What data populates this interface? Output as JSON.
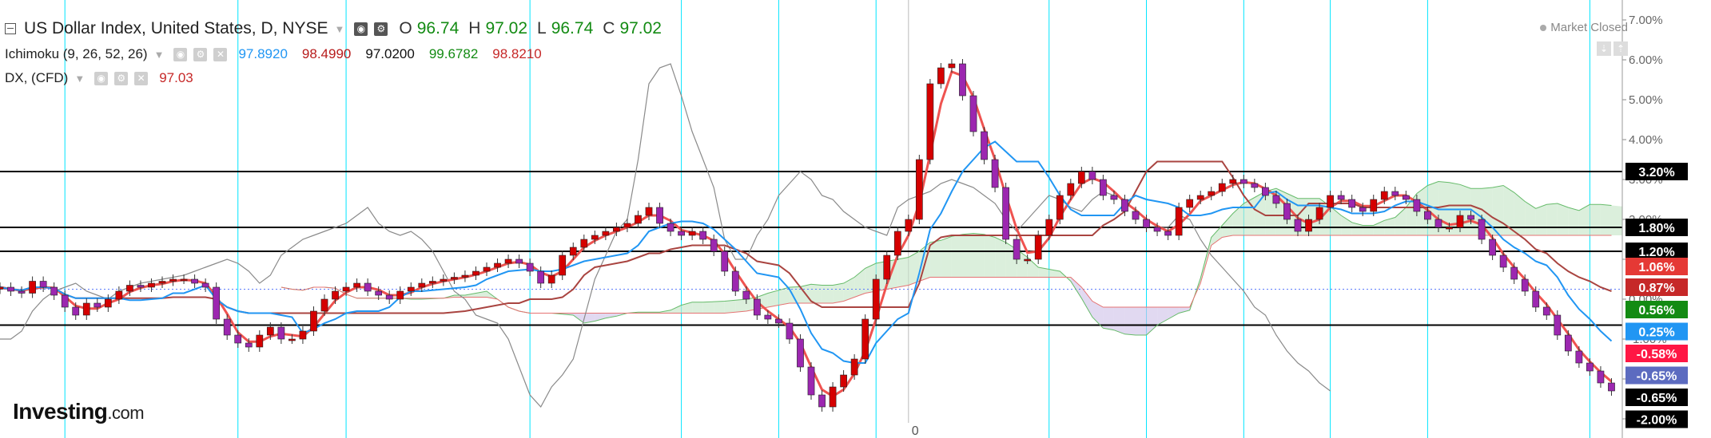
{
  "header": {
    "title": "US Dollar Index, United States, D, NYSE",
    "ohlc": [
      {
        "key": "O",
        "value": "96.74"
      },
      {
        "key": "H",
        "value": "97.02"
      },
      {
        "key": "L",
        "value": "96.74"
      },
      {
        "key": "C",
        "value": "97.02"
      }
    ]
  },
  "indicators": {
    "ichimoku": {
      "label": "Ichimoku (9, 26, 52, 26)",
      "values": [
        {
          "value": "97.8920",
          "color": "#2196f3"
        },
        {
          "value": "98.4990",
          "color": "#b71c1c"
        },
        {
          "value": "97.0200",
          "color": "#111111"
        },
        {
          "value": "99.6782",
          "color": "#138b13"
        },
        {
          "value": "98.8210",
          "color": "#c62828"
        }
      ]
    },
    "dx": {
      "label": "DX, (CFD)",
      "value": "97.03",
      "value_color": "#c62828"
    }
  },
  "status": {
    "market": "Market Closed"
  },
  "logo": {
    "brand": "Investing",
    "suffix": ".com"
  },
  "colors": {
    "up_candle": "#d50000",
    "down_candle": "#9c27b0",
    "tenkan": "#2196f3",
    "kijun": "#a94440",
    "chikou": "#8a8a8a",
    "dx_line": "#ef5350",
    "cloud_bull": "#c8e6c9",
    "cloud_bear": "#d1c4e9",
    "vertical_grid": "#00e5ff"
  },
  "chart_data": {
    "type": "candlestick",
    "y_axis": {
      "unit": "%",
      "range": [
        -3.4,
        7.3
      ],
      "ticks": [
        "7.00%",
        "6.00%",
        "5.00%",
        "4.00%",
        "3.00%",
        "2.00%",
        "1.00%",
        "0.00%",
        "-1.00%",
        "-2.00%",
        "-3.00%"
      ]
    },
    "x_axis_label": "0",
    "x_index_range": [
      0,
      150
    ],
    "baseline_index": 84,
    "baseline_value": 0.25,
    "horizontal_levels": [
      3.2,
      1.8,
      1.2,
      -0.65
    ],
    "price_labels": [
      {
        "text": "3.20%",
        "value": 3.2,
        "color": "#000000"
      },
      {
        "text": "1.80%",
        "value": 1.8,
        "color": "#000000"
      },
      {
        "text": "1.20%",
        "value": 1.2,
        "color": "#000000"
      },
      {
        "text": "1.06%",
        "value": 0.82,
        "color": "#e53935"
      },
      {
        "text": "0.87%",
        "value": 0.3,
        "color": "#c62828"
      },
      {
        "text": "0.56%",
        "value": -0.26,
        "color": "#138b13"
      },
      {
        "text": "0.25%",
        "value": -0.81,
        "color": "#2196f3"
      },
      {
        "text": "-0.58%",
        "value": -1.36,
        "color": "#ff1744"
      },
      {
        "text": "-0.65%",
        "value": -1.91,
        "color": "#5c6bc0"
      },
      {
        "text": "-0.65%",
        "value": -2.46,
        "color": "#000000"
      },
      {
        "text": "-2.00%",
        "value": -3.01,
        "color": "#000000"
      }
    ],
    "vertical_gridlines": [
      6,
      22,
      32,
      49,
      63,
      72,
      81,
      97,
      106,
      115,
      123,
      132,
      147
    ],
    "close": [
      0.3,
      0.2,
      0.15,
      0.45,
      0.3,
      0.1,
      -0.2,
      -0.4,
      -0.1,
      -0.2,
      0.0,
      0.2,
      0.35,
      0.3,
      0.4,
      0.45,
      0.5,
      0.5,
      0.4,
      0.3,
      -0.5,
      -0.9,
      -1.1,
      -1.2,
      -0.9,
      -0.7,
      -1.0,
      -1.0,
      -0.8,
      -0.3,
      0.0,
      0.2,
      0.3,
      0.4,
      0.2,
      0.1,
      0.0,
      0.2,
      0.3,
      0.4,
      0.45,
      0.5,
      0.55,
      0.6,
      0.7,
      0.8,
      0.9,
      1.0,
      0.9,
      0.7,
      0.4,
      0.6,
      1.1,
      1.3,
      1.5,
      1.6,
      1.7,
      1.8,
      1.9,
      2.1,
      2.3,
      1.9,
      1.7,
      1.6,
      1.7,
      1.5,
      1.2,
      0.7,
      0.2,
      0.0,
      -0.4,
      -0.5,
      -0.6,
      -1.0,
      -1.7,
      -2.4,
      -2.7,
      -2.2,
      -1.9,
      -1.5,
      -0.5,
      0.5,
      1.1,
      1.7,
      2.0,
      3.5,
      5.4,
      5.8,
      5.9,
      5.1,
      4.2,
      3.5,
      2.8,
      1.5,
      1.0,
      1.0,
      1.6,
      2.0,
      2.6,
      2.9,
      3.2,
      3.0,
      2.6,
      2.5,
      2.2,
      2.0,
      1.8,
      1.7,
      1.6,
      2.3,
      2.5,
      2.6,
      2.7,
      2.9,
      3.0,
      2.9,
      2.8,
      2.6,
      2.4,
      2.0,
      1.7,
      2.0,
      2.3,
      2.6,
      2.5,
      2.3,
      2.2,
      2.5,
      2.7,
      2.6,
      2.5,
      2.2,
      2.0,
      1.8,
      1.8,
      2.1,
      2.0,
      1.5,
      1.1,
      0.8,
      0.5,
      0.2,
      -0.2,
      -0.4,
      -0.9,
      -1.3,
      -1.6,
      -1.8,
      -2.1,
      -2.3
    ]
  }
}
